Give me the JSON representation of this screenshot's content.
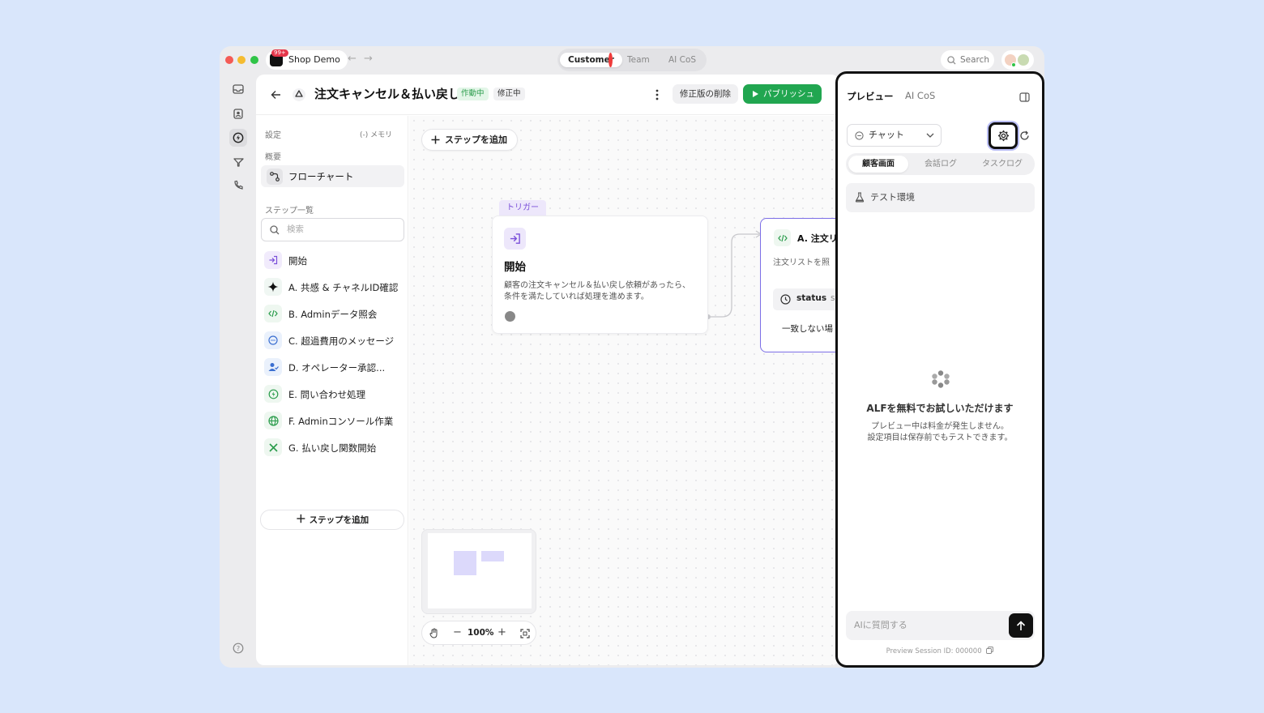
{
  "app": {
    "name": "Shop Demo",
    "badge": "99+",
    "workspace_tabs": [
      "Customer",
      "Team",
      "AI CoS"
    ],
    "search_label": "Search"
  },
  "header": {
    "title": "注文キャンセル＆払い戻し",
    "status_active": "作動中",
    "status_editing": "修正中",
    "delete_revision_label": "修正版の削除",
    "publish_label": "パブリッシュ"
  },
  "sidebar": {
    "settings_label": "設定",
    "memory_label": "メモリ",
    "overview_label": "概要",
    "flowchart_label": "フローチャート",
    "steps_heading": "ステップ一覧",
    "search_placeholder": "検索",
    "steps": [
      "開始",
      "A. 共感 & チャネルID確認",
      "B. Adminデータ照会",
      "C. 超過費用のメッセージ",
      "D. オペレーター承認...",
      "E. 問い合わせ処理",
      "F. Adminコンソール作業",
      "G. 払い戻し関数開始"
    ],
    "add_step_label": "ステップを追加"
  },
  "canvas": {
    "add_step_label": "ステップを追加",
    "trigger_tag": "トリガー",
    "start_card": {
      "title": "開始",
      "description": "顧客の注文キャンセル＆払い戻し依頼があったら、条件を満たしていれば処理を進めます。"
    },
    "next_card": {
      "title": "A. 注文リ",
      "description": "注文リストを照",
      "status_label": "status",
      "status_suffix": "s",
      "mismatch_label": "一致しない場"
    },
    "zoom_level": "100%"
  },
  "preview": {
    "tab_preview": "プレビュー",
    "tab_aicos": "AI CoS",
    "channel_select": "チャット",
    "view_tabs": [
      "顧客画面",
      "会話ログ",
      "タスクログ"
    ],
    "test_env_label": "テスト環境",
    "promo_title": "ALFを無料でお試しいただけます",
    "promo_line1": "プレビュー中は料金が発生しません。",
    "promo_line2": "設定項目は保存前でもテストできます。",
    "ask_placeholder": "AIに質問する",
    "session_id": "Preview Session ID: 000000"
  },
  "colors": {
    "accent_green": "#21a650",
    "accent_purple": "#7c6ee6",
    "background": "#d9e6fb"
  }
}
